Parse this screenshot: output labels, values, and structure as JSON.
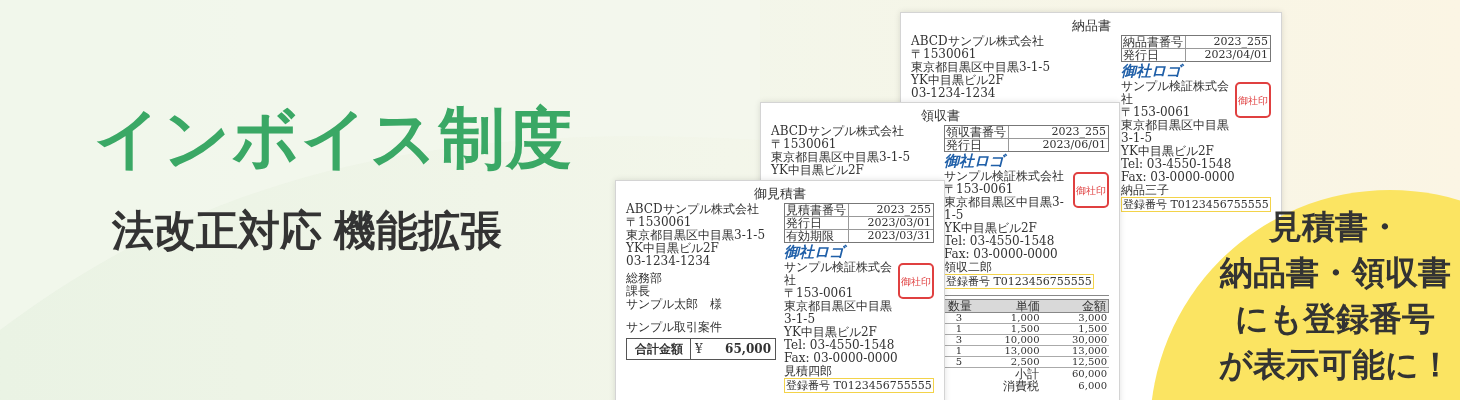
{
  "headline": {
    "title": "インボイス制度",
    "subtitle": "法改正対応 機能拡張"
  },
  "callout": {
    "lines": [
      "見積書・",
      "納品書・領収書",
      "にも登録番号",
      "が表示可能に！"
    ]
  },
  "documents": [
    {
      "title": "納品書",
      "issuer": [
        "ABCDサンプル株式会社",
        "〒1530061",
        "東京都目黒区中目黒3-1-5",
        "YK中目黒ビル2F",
        "03-1234-1234"
      ],
      "meta": [
        {
          "label": "納品書番号",
          "value": "2023_255"
        },
        {
          "label": "発行日",
          "value": "2023/04/01"
        }
      ],
      "logo": "御社ロゴ",
      "company": "サンプル検証株式会社",
      "address": [
        "〒153-0061",
        "東京都目黒区中目黒3-1-5",
        "YK中目黒ビル2F"
      ],
      "contact": [
        "Tel: 03-4550-1548",
        "Fax: 03-0000-0000"
      ],
      "staff": "納品三子",
      "registration": "登録番号 T0123456755555",
      "seal": "御社印"
    },
    {
      "title": "領収書",
      "issuer": [
        "ABCDサンプル株式会社",
        "〒1530061",
        "東京都目黒区中目黒3-1-5",
        "YK中目黒ビル2F"
      ],
      "meta": [
        {
          "label": "領収書番号",
          "value": "2023_255"
        },
        {
          "label": "発行日",
          "value": "2023/06/01"
        }
      ],
      "logo": "御社ロゴ",
      "company": "サンプル検証株式会社",
      "address": [
        "〒153-0061",
        "東京都目黒区中目黒3-1-5",
        "YK中目黒ビル2F"
      ],
      "contact": [
        "Tel: 03-4550-1548",
        "Fax: 03-0000-0000"
      ],
      "staff": "領収二郎",
      "registration": "登録番号 T0123456755555",
      "seal": "御社印",
      "items": {
        "columns": [
          "数量",
          "単価",
          "金額"
        ],
        "rows": [
          [
            "3",
            "1,000",
            "3,000"
          ],
          [
            "1",
            "1,500",
            "1,500"
          ],
          [
            "3",
            "10,000",
            "30,000"
          ],
          [
            "1",
            "13,000",
            "13,000"
          ],
          [
            "5",
            "2,500",
            "12,500"
          ]
        ]
      },
      "summary": [
        {
          "label": "小計",
          "value": "60,000"
        },
        {
          "label": "消費税",
          "value": "6,000"
        }
      ]
    },
    {
      "title": "御見積書",
      "issuer": [
        "ABCDサンプル株式会社",
        "〒1530061",
        "東京都目黒区中目黒3-1-5",
        "YK中目黒ビル2F",
        "03-1234-1234"
      ],
      "recipient": [
        "総務部",
        "課長",
        "サンプル太郎　様"
      ],
      "subject": "サンプル取引案件",
      "total": {
        "label": "合計金額",
        "currency": "¥",
        "value": "65,000"
      },
      "meta": [
        {
          "label": "見積書番号",
          "value": "2023_255"
        },
        {
          "label": "発行日",
          "value": "2023/03/01"
        },
        {
          "label": "有効期限",
          "value": "2023/03/31"
        }
      ],
      "logo": "御社ロゴ",
      "company": "サンプル検証株式会社",
      "address": [
        "〒153-0061",
        "東京都目黒区中目黒3-1-5",
        "YK中目黒ビル2F"
      ],
      "contact": [
        "Tel: 03-4550-1548",
        "Fax: 03-0000-0000"
      ],
      "staff": "見積四郎",
      "registration": "登録番号 T0123456755555",
      "seal": "御社印"
    }
  ]
}
